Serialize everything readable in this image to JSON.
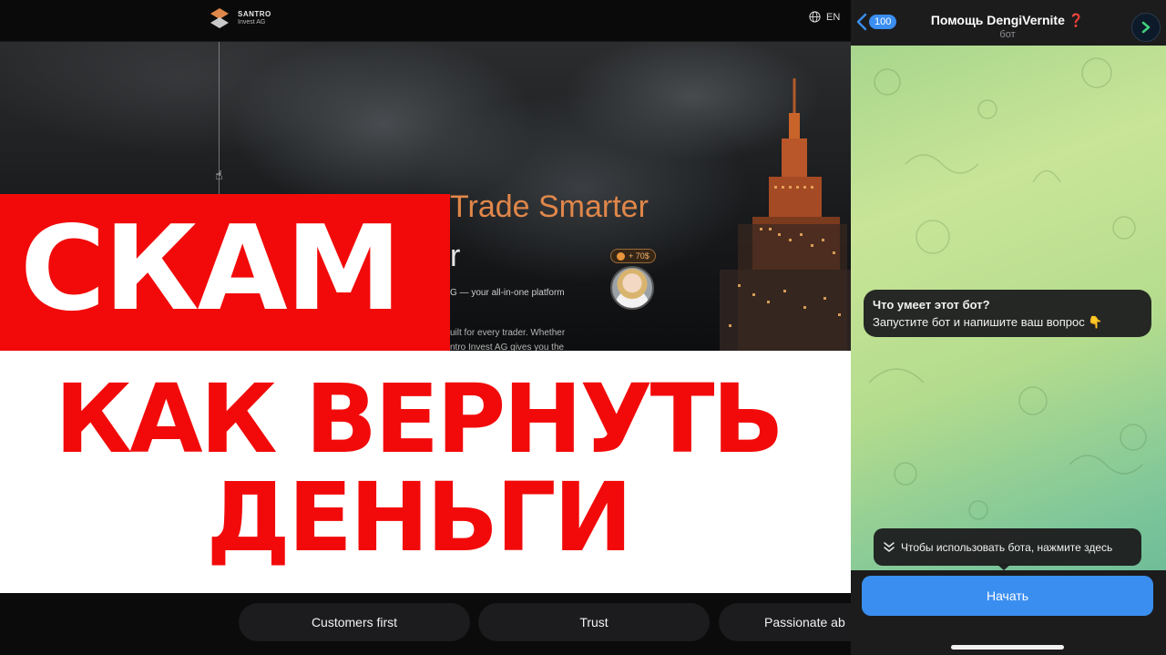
{
  "site": {
    "logo_name": "SANTRO",
    "logo_sub": "Invest AG",
    "lang": "EN",
    "hero_title_1": "Trade Smarter",
    "hero_title_2": "r",
    "hero_desc_1": "G — your all-in-one platform",
    "hero_desc_2a": "uilt for every trader. Whether",
    "hero_desc_2b": "ntro Invest AG gives you the",
    "profit_badge": "+ 70$",
    "values": [
      "Customers first",
      "Trust",
      "Passionate ab"
    ]
  },
  "overlay": {
    "line_red": "СКАМ",
    "line_white_1": "КАК ВЕРНУТЬ",
    "line_white_2": "ДЕНЬГИ",
    "colors": {
      "red": "#f20a0a",
      "white": "#ffffff"
    }
  },
  "telegram": {
    "back_count": "100",
    "chat_title": "Помощь DengiVernite",
    "chat_title_mark": "❓",
    "chat_subtitle": "бот",
    "bubble_title": "Что умеет этот бот?",
    "bubble_text": "Запустите бот и напишите ваш вопрос 👇",
    "hint_text": "Чтобы использовать бота, нажмите здесь",
    "start_button": "Начать",
    "colors": {
      "accent": "#3a8ef0",
      "header": "#1c1c1d"
    }
  }
}
